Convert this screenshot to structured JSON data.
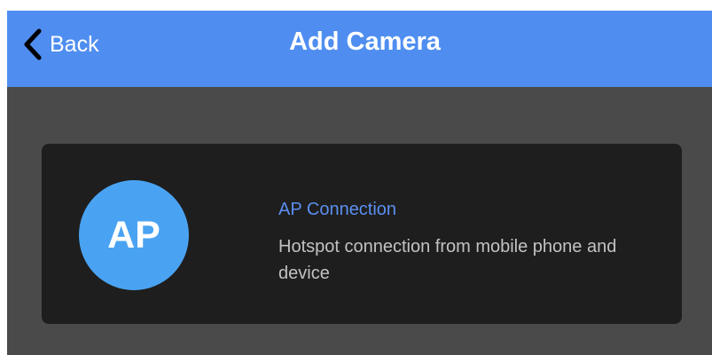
{
  "header": {
    "back_label": "Back",
    "title": "Add Camera",
    "back_icon": "chevron-left-icon",
    "background_color": "#4f8ef0"
  },
  "options": [
    {
      "badge": "AP",
      "title": "AP Connection",
      "description": "Hotspot connection from mobile phone and device",
      "badge_color": "#4aa3f2",
      "title_color": "#5b8ff0"
    }
  ],
  "colors": {
    "screen_background": "#4a4a4a",
    "card_background": "#1e1e1e"
  }
}
